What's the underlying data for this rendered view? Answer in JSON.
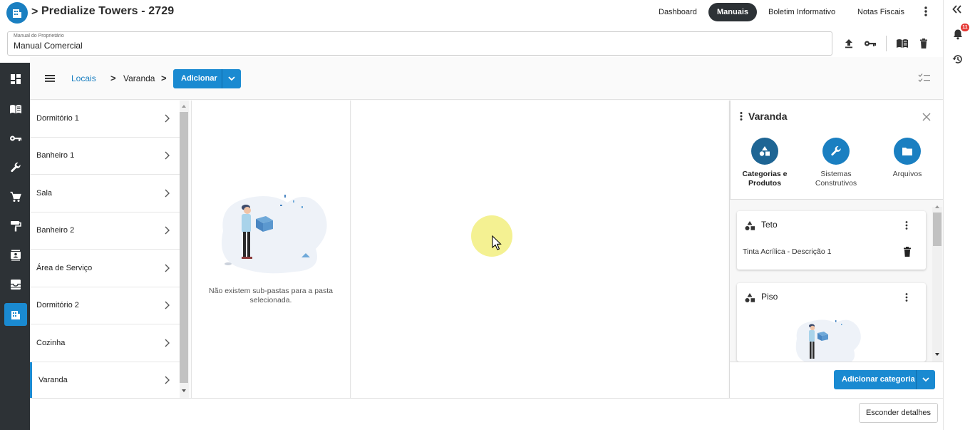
{
  "header": {
    "title": "Predialize Towers - 2729",
    "breadcrumb_chevron": ">",
    "tabs": [
      {
        "label": "Dashboard",
        "active": false
      },
      {
        "label": "Manuais",
        "active": true
      },
      {
        "label": "Boletim Informativo",
        "active": false
      },
      {
        "label": "Notas Fiscais",
        "active": false
      }
    ]
  },
  "manual": {
    "label": "Manual do Proprietário",
    "value": "Manual Comercial"
  },
  "toolbar": {
    "breadcrumb_root": "Locais",
    "breadcrumb_current": "Varanda",
    "separator": ">",
    "add_button": "Adicionar"
  },
  "folders": [
    {
      "label": "Dormitório 1"
    },
    {
      "label": "Banheiro 1"
    },
    {
      "label": "Sala"
    },
    {
      "label": "Banheiro 2"
    },
    {
      "label": "Área de Serviço"
    },
    {
      "label": "Dormitório 2"
    },
    {
      "label": "Cozinha"
    },
    {
      "label": "Varanda"
    }
  ],
  "subfolders": {
    "empty_text": "Não existem sub-pastas para a pasta selecionada."
  },
  "details": {
    "title": "Varanda",
    "actions": [
      {
        "label": "Categorias e Produtos",
        "icon": "shapes-icon"
      },
      {
        "label": "Sistemas Construtivos",
        "icon": "wrench-icon"
      },
      {
        "label": "Arquivos",
        "icon": "folder-icon"
      }
    ],
    "categories": [
      {
        "title": "Teto",
        "product": "Tinta Acrílica - Descrição 1"
      },
      {
        "title": "Piso",
        "product": ""
      }
    ],
    "add_category_button": "Adicionar categoria"
  },
  "footer": {
    "hide_details_button": "Esconder detalhes"
  },
  "notifications": {
    "count": "11"
  },
  "colors": {
    "primary": "#1a8ad1",
    "sidebar": "#2d3236",
    "active_tab": "#2d3236",
    "badge": "#e53935"
  }
}
